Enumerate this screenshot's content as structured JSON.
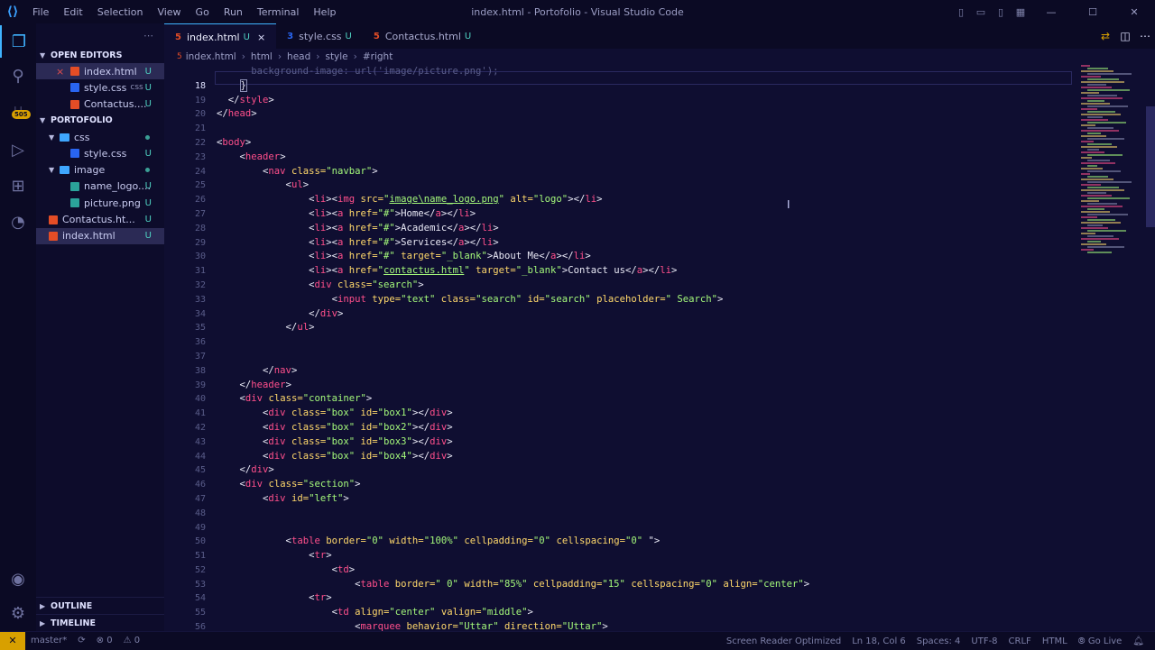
{
  "window": {
    "title": "index.html - Portofolio - Visual Studio Code",
    "menu": [
      "File",
      "Edit",
      "Selection",
      "View",
      "Go",
      "Run",
      "Terminal",
      "Help"
    ]
  },
  "activity": {
    "badge": "505"
  },
  "sidebar": {
    "open_editors_label": "OPEN EDITORS",
    "open_editors": [
      {
        "name": "index.html",
        "ext": "",
        "status": "U",
        "type": "html",
        "selected": true,
        "close": "×"
      },
      {
        "name": "style.css",
        "ext": "css",
        "status": "U",
        "type": "css",
        "selected": false
      },
      {
        "name": "Contactus....",
        "ext": "",
        "status": "U",
        "type": "html",
        "selected": false
      }
    ],
    "project_label": "PORTOFOLIO",
    "tree": [
      {
        "name": "css",
        "type": "folder",
        "indent": 1
      },
      {
        "name": "style.css",
        "type": "css",
        "indent": 2,
        "status": "U"
      },
      {
        "name": "image",
        "type": "folder",
        "indent": 1
      },
      {
        "name": "name_logo....",
        "type": "img",
        "indent": 2,
        "status": "U"
      },
      {
        "name": "picture.png",
        "type": "img",
        "indent": 2,
        "status": "U"
      },
      {
        "name": "Contactus.ht...",
        "type": "html",
        "indent": 1,
        "status": "U"
      },
      {
        "name": "index.html",
        "type": "html",
        "indent": 1,
        "status": "U",
        "selected": true
      }
    ],
    "outline_label": "OUTLINE",
    "timeline_label": "TIMELINE"
  },
  "tabs": [
    {
      "label": "index.html",
      "status": "U",
      "type": "html",
      "active": true,
      "close": "×"
    },
    {
      "label": "style.css",
      "status": "U",
      "type": "css",
      "active": false
    },
    {
      "label": "Contactus.html",
      "status": "U",
      "type": "html",
      "active": false
    }
  ],
  "breadcrumb": [
    "index.html",
    "html",
    "head",
    "style",
    "#right"
  ],
  "editor": {
    "current_line": "18",
    "line_numbers": [
      "",
      "18",
      "19",
      "20",
      "21",
      "22",
      "23",
      "24",
      "25",
      "26",
      "27",
      "28",
      "29",
      "30",
      "31",
      "32",
      "33",
      "34",
      "35",
      "36",
      "37",
      "38",
      "39",
      "40",
      "41",
      "42",
      "43",
      "44",
      "45",
      "46",
      "47",
      "48",
      "49",
      "50",
      "51",
      "52",
      "53",
      "54",
      "55",
      "56"
    ]
  },
  "status": {
    "branch": "master*",
    "sync": "⟳",
    "errors": "⊗ 0",
    "warnings": "⚠ 0",
    "screen_reader": "Screen Reader Optimized",
    "position": "Ln 18, Col 6",
    "spaces": "Spaces: 4",
    "encoding": "UTF-8",
    "eol": "CRLF",
    "language": "HTML",
    "golive": "Go Live"
  }
}
